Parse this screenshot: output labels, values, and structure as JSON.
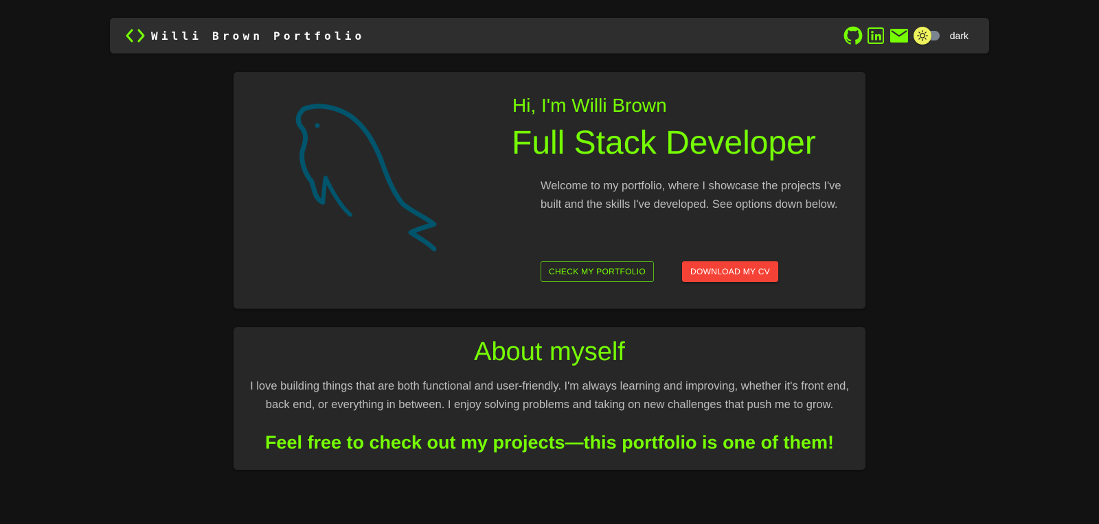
{
  "header": {
    "title": "Willi Brown Portfolio",
    "theme_label": "dark",
    "icons": [
      "code-icon",
      "github-icon",
      "linkedin-icon",
      "mail-icon",
      "sun-icon"
    ]
  },
  "hero": {
    "greeting": "Hi, I'm Willi Brown",
    "headline": "Full Stack Developer",
    "welcome": "Welcome to my portfolio, where I showcase the projects I've built and the skills I've developed. See options down below.",
    "portfolio_button": "Check my portfolio",
    "cv_button": "Download my CV",
    "image_icon": "mysql-dolphin-icon"
  },
  "about": {
    "title": "About myself",
    "text": "I love building things that are both functional and user-friendly. I'm always learning and improving, whether it's front end, back end, or everything in between. I enjoy solving problems and taking on new challenges that push me to grow.",
    "cta": "Feel free to check out my projects—this portfolio is one of them!"
  },
  "colors": {
    "background": "#121212",
    "card": "#272727",
    "navbar": "#2e2e2e",
    "accent": "#76ff03",
    "body_text": "#bdbdbd",
    "cv_button": "#f44336",
    "dolphin": "#00546b",
    "toggle_thumb": "#eef25c"
  }
}
